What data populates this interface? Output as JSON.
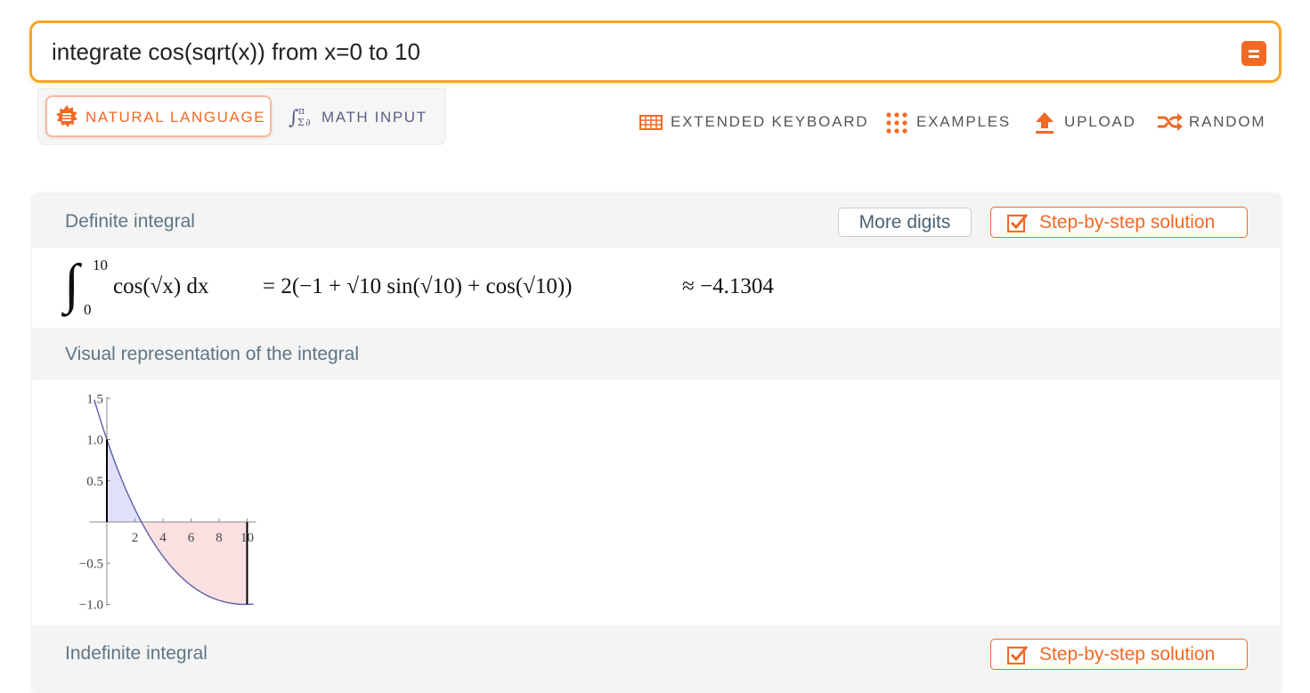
{
  "search": {
    "query": "integrate cos(sqrt(x)) from x=0 to 10",
    "submit_icon": "equals-icon"
  },
  "input_modes": [
    {
      "label": "NATURAL LANGUAGE",
      "icon": "natural-language-icon",
      "active": true
    },
    {
      "label": "MATH INPUT",
      "icon": "math-input-icon",
      "active": false
    }
  ],
  "toolbar": {
    "keyboard": "EXTENDED KEYBOARD",
    "examples": "EXAMPLES",
    "upload": "UPLOAD",
    "random": "RANDOM"
  },
  "pods": {
    "definite": {
      "title": "Definite integral",
      "more_digits": "More digits",
      "step_by_step": "Step-by-step solution",
      "result": {
        "upper": "10",
        "lower": "0",
        "integrand": "cos(√x) dx",
        "equals": "= 2(−1 + √10 sin(√10) + cos(√10))",
        "approx": "≈ −4.1304"
      }
    },
    "visual": {
      "title": "Visual representation of the integral"
    },
    "indefinite": {
      "title": "Indefinite integral",
      "step_by_step": "Step-by-step solution"
    }
  },
  "chart_data": {
    "type": "area",
    "function": "cos(sqrt(x))",
    "x_range": [
      -1,
      10.5
    ],
    "y_range": [
      -1.0,
      1.5
    ],
    "shade_from": 0,
    "shade_to": 10,
    "x_ticks": [
      2,
      4,
      6,
      8,
      10
    ],
    "x_tick_labels": [
      "2",
      "4",
      "6",
      "8",
      "10"
    ],
    "y_ticks": [
      -1.0,
      -0.5,
      0.5,
      1.0,
      1.5
    ],
    "y_tick_labels": [
      "−1.0",
      "−0.5",
      "0.5",
      "1.0",
      "1.5"
    ],
    "colors": {
      "curve": "#5e5eaa",
      "positive_fill": "#e0e0fa",
      "negative_fill": "#fae0e0",
      "bounds": "#000000"
    }
  },
  "colors": {
    "accent": "#f06a25",
    "search_border": "#f5a623",
    "pod_title": "#5f7585"
  }
}
